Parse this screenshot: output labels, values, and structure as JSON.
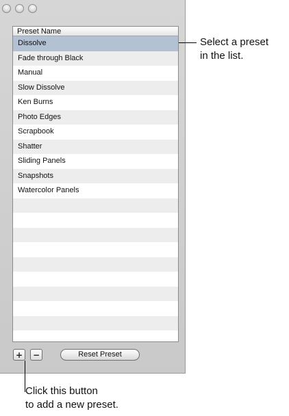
{
  "window": {
    "traffic_lights": [
      "close",
      "minimize",
      "zoom"
    ]
  },
  "list": {
    "header": "Preset Name",
    "selected_index": 0,
    "rows": [
      "Dissolve",
      "Fade through Black",
      "Manual",
      "Slow Dissolve",
      "Ken Burns",
      "Photo Edges",
      "Scrapbook",
      "Shatter",
      "Sliding Panels",
      "Snapshots",
      "Watercolor Panels",
      "",
      "",
      "",
      "",
      "",
      "",
      "",
      "",
      "",
      ""
    ]
  },
  "toolbar": {
    "add_label": "+",
    "remove_label": "−",
    "reset_label": "Reset Preset"
  },
  "callouts": {
    "select_line1": "Select a preset",
    "select_line2": "in the list.",
    "add_line1": "Click this button",
    "add_line2": "to add a new preset."
  },
  "colors": {
    "selection": "#b3c1d5",
    "stripe": "#ededed"
  }
}
